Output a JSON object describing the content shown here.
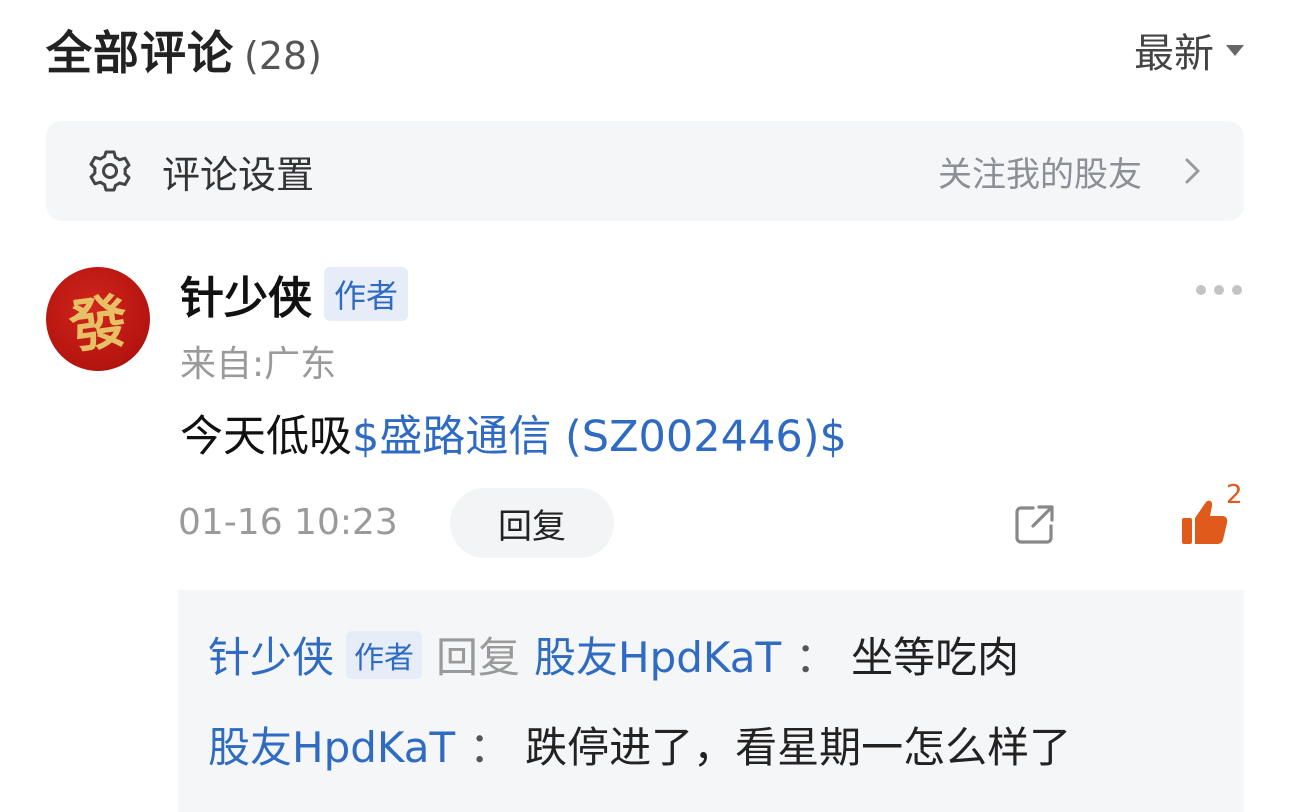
{
  "header": {
    "title": "全部评论",
    "count": "(28)",
    "sort_label": "最新"
  },
  "settings": {
    "label": "评论设置",
    "right_label": "关注我的股友"
  },
  "comment": {
    "avatar_char": "發",
    "author": "针少侠",
    "badge": "作者",
    "location": "来自:广东",
    "text_prefix": "今天低吸",
    "stock": "$盛路通信 (SZ002446)$",
    "time": "01-16 10:23",
    "reply_label": "回复",
    "like_count": "2"
  },
  "replies": [
    {
      "from": "针少侠",
      "badge": "作者",
      "verb": "回复",
      "to": "股友HpdKaT",
      "colon": "：",
      "text": "坐等吃肉"
    },
    {
      "from": "股友HpdKaT",
      "colon": "：",
      "text": "跌停进了，看星期一怎么样了"
    }
  ],
  "colors": {
    "link_blue": "#2f6bc2",
    "like_orange": "#e05a1b",
    "panel_gray": "#f5f6f8"
  }
}
